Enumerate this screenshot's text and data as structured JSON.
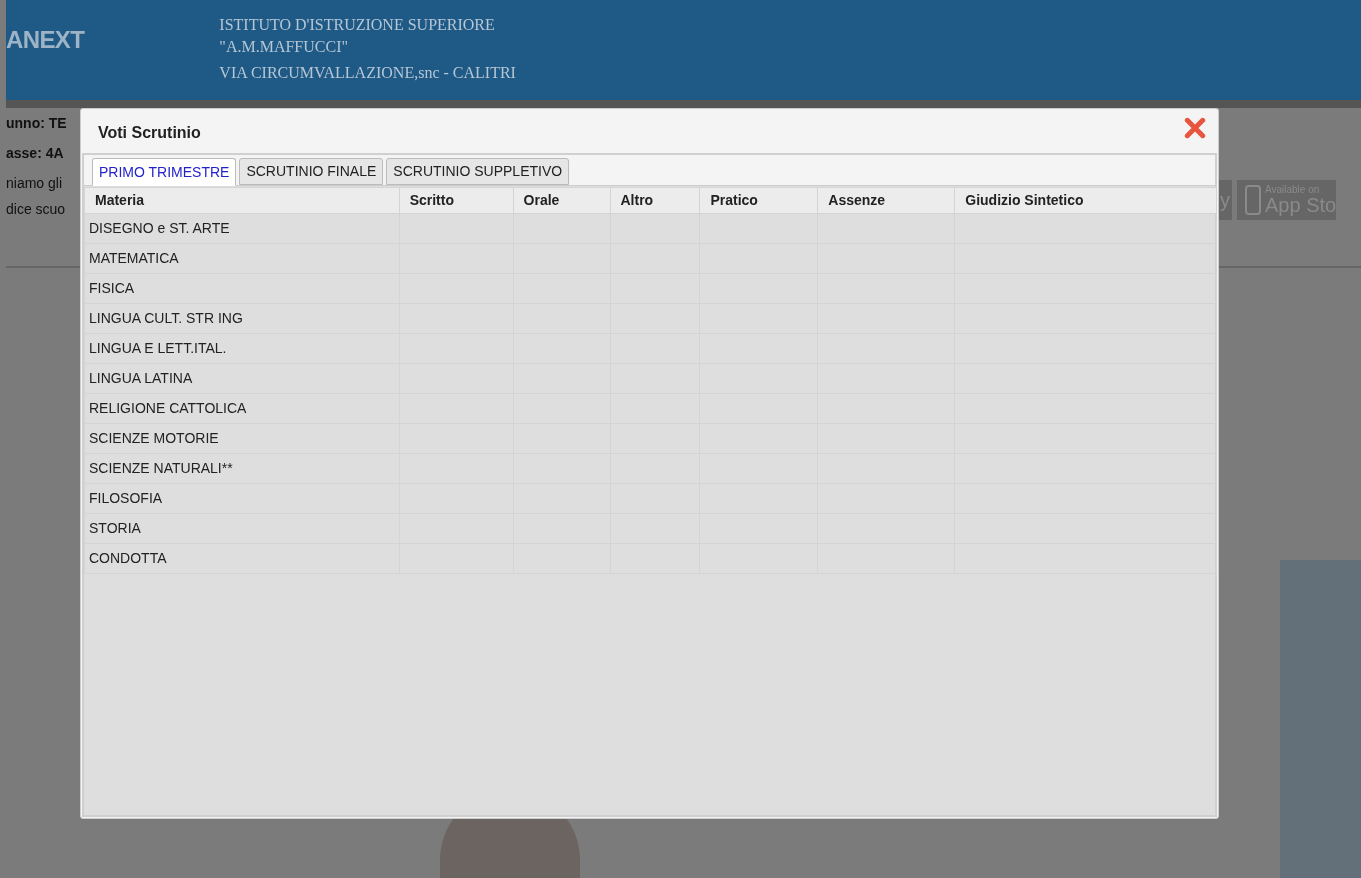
{
  "header": {
    "logo": "ANEXT",
    "school_lines": [
      "ISTITUTO D'ISTRUZIONE SUPERIORE",
      "\"A.M.MAFFUCCI\"",
      "VIA CIRCUMVALLAZIONE,snc - CALITRI"
    ]
  },
  "page_fragments": [
    "unno: TE",
    "asse: 4A",
    "niamo gli",
    "dice scuo"
  ],
  "store_badges": [
    {
      "kind": "play",
      "text": "y"
    },
    {
      "kind": "appstore",
      "small": "Available on",
      "text": "App Sto"
    }
  ],
  "dialog": {
    "title": "Voti Scrutinio",
    "tabs": [
      {
        "label": "PRIMO TRIMESTRE",
        "selected": true
      },
      {
        "label": "SCRUTINIO FINALE",
        "selected": false
      },
      {
        "label": "SCRUTINIO SUPPLETIVO",
        "selected": false
      }
    ],
    "table": {
      "columns": [
        "Materia",
        "Scritto",
        "Orale",
        "Altro",
        "Pratico",
        "Assenze",
        "Giudizio Sintetico"
      ],
      "rows": [
        [
          "DISEGNO e ST. ARTE"
        ],
        [
          "MATEMATICA"
        ],
        [
          "FISICA"
        ],
        [
          "LINGUA CULT. STR ING"
        ],
        [
          "LINGUA E LETT.ITAL."
        ],
        [
          "LINGUA LATINA"
        ],
        [
          "RELIGIONE CATTOLICA"
        ],
        [
          "SCIENZE MOTORIE"
        ],
        [
          "SCIENZE NATURALI**"
        ],
        [
          "FILOSOFIA"
        ],
        [
          "STORIA"
        ],
        [
          "CONDOTTA"
        ]
      ]
    }
  }
}
